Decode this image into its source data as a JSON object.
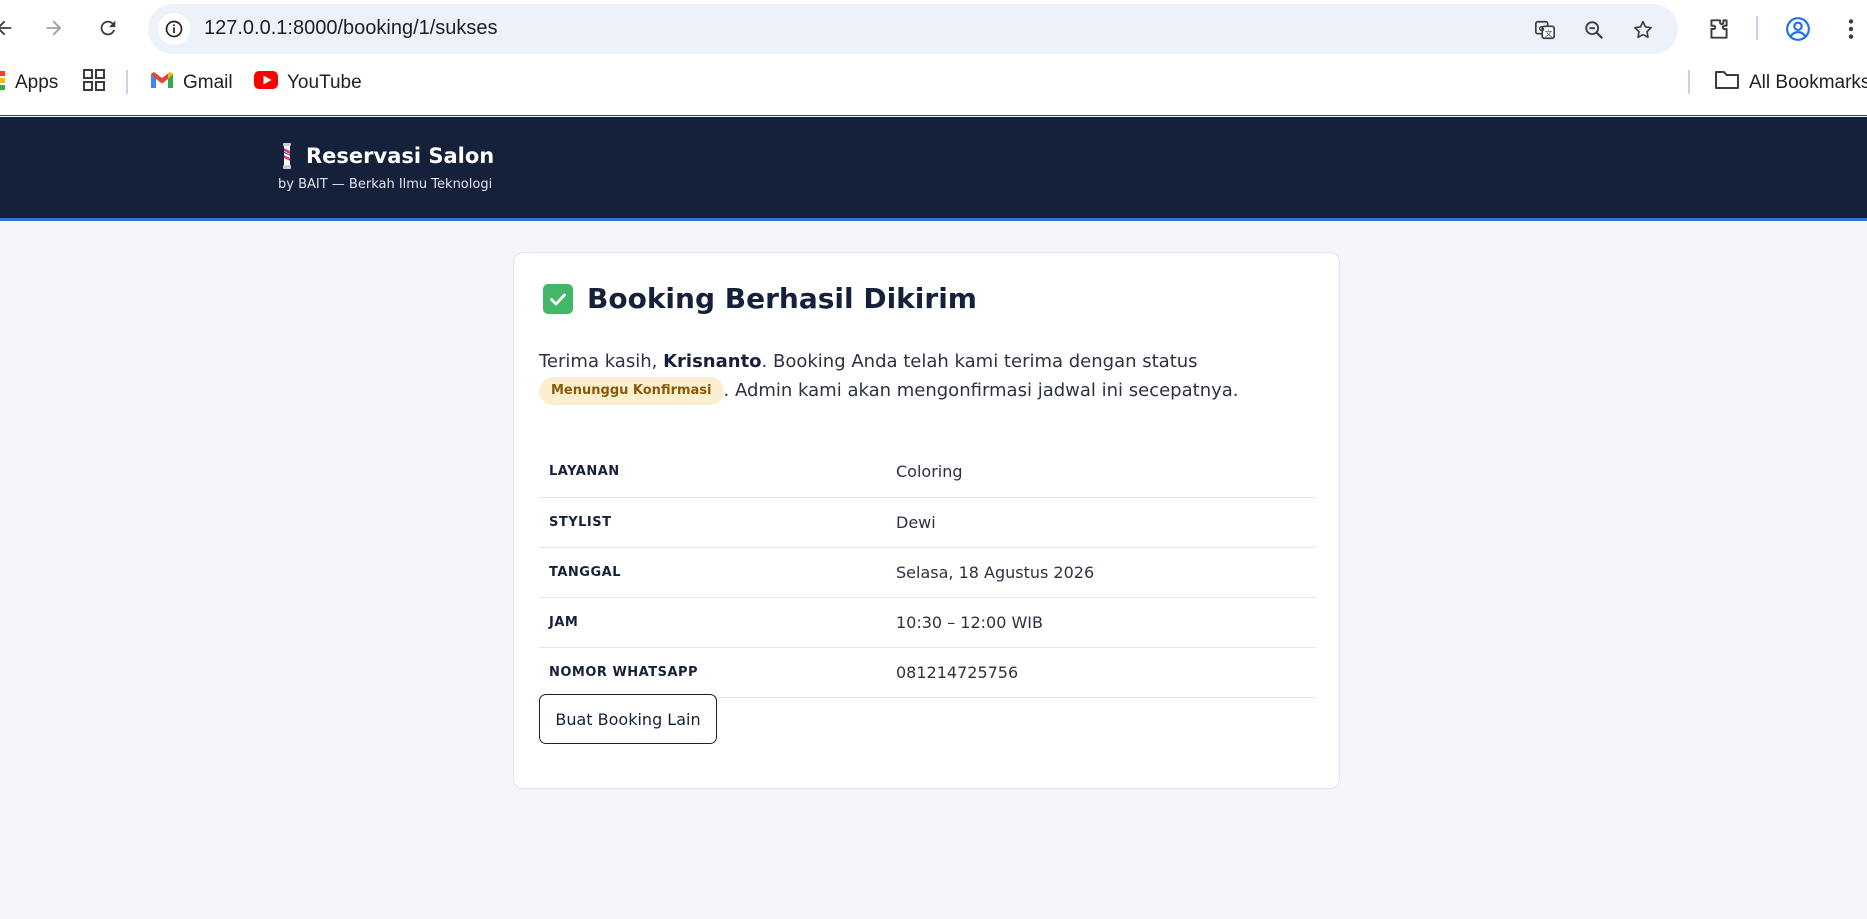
{
  "browser": {
    "url": "127.0.0.1:8000/booking/1/sukses",
    "bookmarks": [
      {
        "label": "Apps"
      },
      {
        "label": "Gmail"
      },
      {
        "label": "YouTube"
      }
    ],
    "all_bookmarks_label": "All Bookmarks"
  },
  "header": {
    "title": "Reservasi Salon",
    "subtitle": "by BAIT — Berkah Ilmu Teknologi"
  },
  "card": {
    "title": "Booking Berhasil Dikirim",
    "message": {
      "prefix": "Terima kasih, ",
      "name": "Krisnanto",
      "middle": ". Booking Anda telah kami terima dengan status ",
      "status": "Menunggu Konfirmasi",
      "suffix": ". Admin kami akan mengonfirmasi jadwal ini secepatnya."
    },
    "details": [
      {
        "label": "LAYANAN",
        "value": "Coloring"
      },
      {
        "label": "STYLIST",
        "value": "Dewi"
      },
      {
        "label": "TANGGAL",
        "value": "Selasa, 18 Agustus 2026"
      },
      {
        "label": "JAM",
        "value": "10:30 – 12:00 WIB"
      },
      {
        "label": "NOMOR WHATSAPP",
        "value": "081214725756"
      }
    ],
    "button_label": "Buat Booking Lain"
  },
  "colors": {
    "header_bg": "#15213a",
    "header_accent": "#3a6ed8",
    "status_badge_bg": "#fcefd0",
    "status_badge_text": "#8a5a0a",
    "success_check": "#43b768"
  },
  "icons": [
    "back-icon",
    "forward-icon",
    "reload-icon",
    "site-info-icon",
    "translate-icon",
    "zoom-icon",
    "bookmark-star-icon",
    "extensions-icon",
    "profile-icon",
    "menu-icon",
    "apps-icon",
    "gmail-icon",
    "youtube-icon",
    "folder-icon",
    "barber-pole-icon",
    "check-icon"
  ]
}
